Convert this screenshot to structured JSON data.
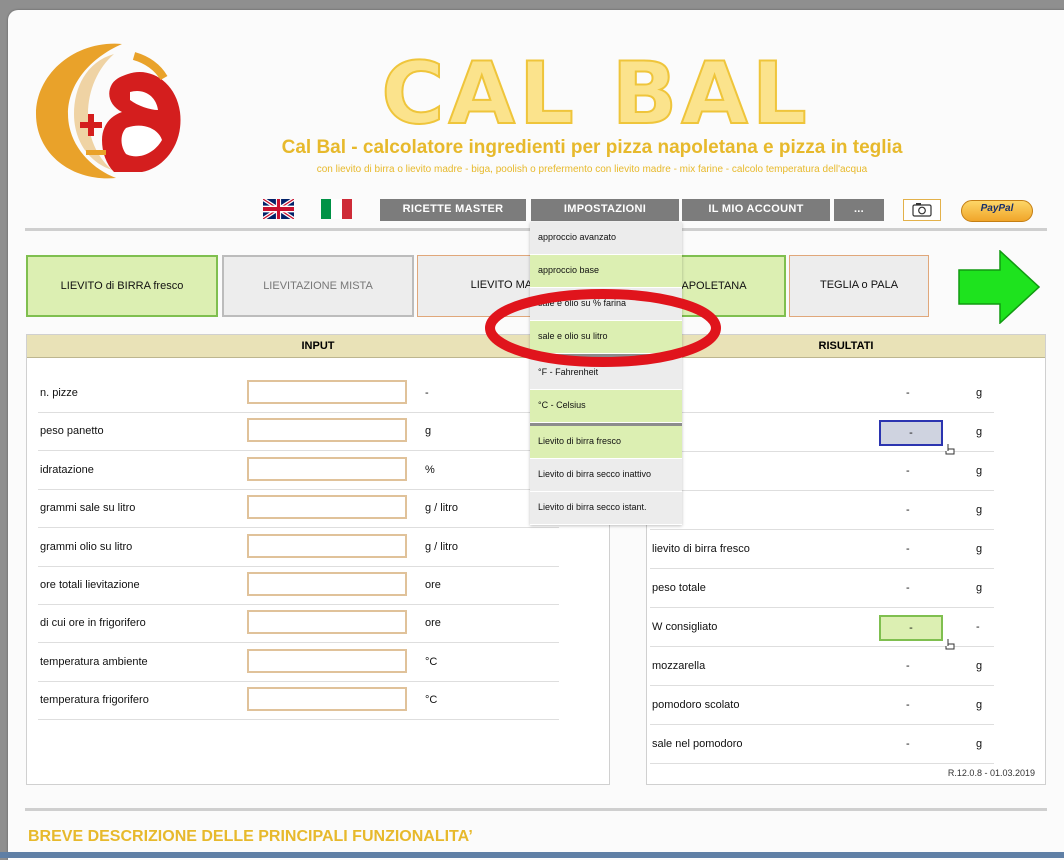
{
  "header": {
    "brand": "CAL BAL",
    "title": "Cal Bal - calcolatore ingredienti per pizza napoletana e pizza in teglia",
    "subtitle": "con lievito di birra o lievito madre - biga, poolish o prefermento con lievito madre - mix farine - calcolo temperatura dell'acqua"
  },
  "nav": {
    "ricette": "RICETTE MASTER",
    "impostazioni": "IMPOSTAZIONI",
    "account": "IL MIO ACCOUNT",
    "more": "...",
    "paypal": "PayPal"
  },
  "mode_tabs": {
    "lievito_birra": "LIEVITO di BIRRA fresco",
    "mista": "LIEVITAZIONE MISTA",
    "madre": "LIEVITO MADRE",
    "napoletana": "NAPOLETANA",
    "teglia": "TEGLIA o PALA"
  },
  "input": {
    "header": "INPUT",
    "rows": [
      {
        "label": "n. pizze",
        "unit": "-"
      },
      {
        "label": "peso panetto",
        "unit": "g"
      },
      {
        "label": "idratazione",
        "unit": "%"
      },
      {
        "label": "grammi sale su litro",
        "unit": "g / litro"
      },
      {
        "label": "grammi olio su litro",
        "unit": "g / litro"
      },
      {
        "label": "ore totali lievitazione",
        "unit": "ore"
      },
      {
        "label": "di cui ore in frigorifero",
        "unit": "ore"
      },
      {
        "label": "temperatura ambiente",
        "unit": "°C"
      },
      {
        "label": "temperatura frigorifero",
        "unit": "°C"
      }
    ]
  },
  "results": {
    "header": "RISULTATI",
    "rows": [
      {
        "label": "",
        "value": "-",
        "unit": "g"
      },
      {
        "label": "",
        "value": "-",
        "unit": "g"
      },
      {
        "label": "",
        "value": "-",
        "unit": "g"
      },
      {
        "label": "",
        "value": "-",
        "unit": "g"
      },
      {
        "label": "lievito di birra fresco",
        "value": "-",
        "unit": "g"
      },
      {
        "label": "peso totale",
        "value": "-",
        "unit": "g"
      },
      {
        "label": "W consigliato",
        "value": "-",
        "unit": "-"
      },
      {
        "label": "mozzarella",
        "value": "-",
        "unit": "g"
      },
      {
        "label": "pomodoro scolato",
        "value": "-",
        "unit": "g"
      },
      {
        "label": "sale nel pomodoro",
        "value": "-",
        "unit": "g"
      }
    ],
    "version": "R.12.0.8 - 01.03.2019"
  },
  "dropdown": {
    "items": [
      "approccio avanzato",
      "approccio base",
      "sale e olio su % farina",
      "sale e olio su litro",
      "°F - Fahrenheit",
      "°C - Celsius",
      "Lievito di birra fresco",
      "Lievito di birra secco inattivo",
      "Lievito di birra secco istant."
    ]
  },
  "section": {
    "heading": "BREVE DESCRIZIONE DELLE PRINCIPALI FUNZIONALITA’"
  },
  "colors": {
    "accent_yellow": "#e7b92c",
    "selected_green": "#dcefb2",
    "nav_gray": "#7c7c7c",
    "panel_header": "#e9e2b7",
    "annotation_red": "#e0141c"
  }
}
